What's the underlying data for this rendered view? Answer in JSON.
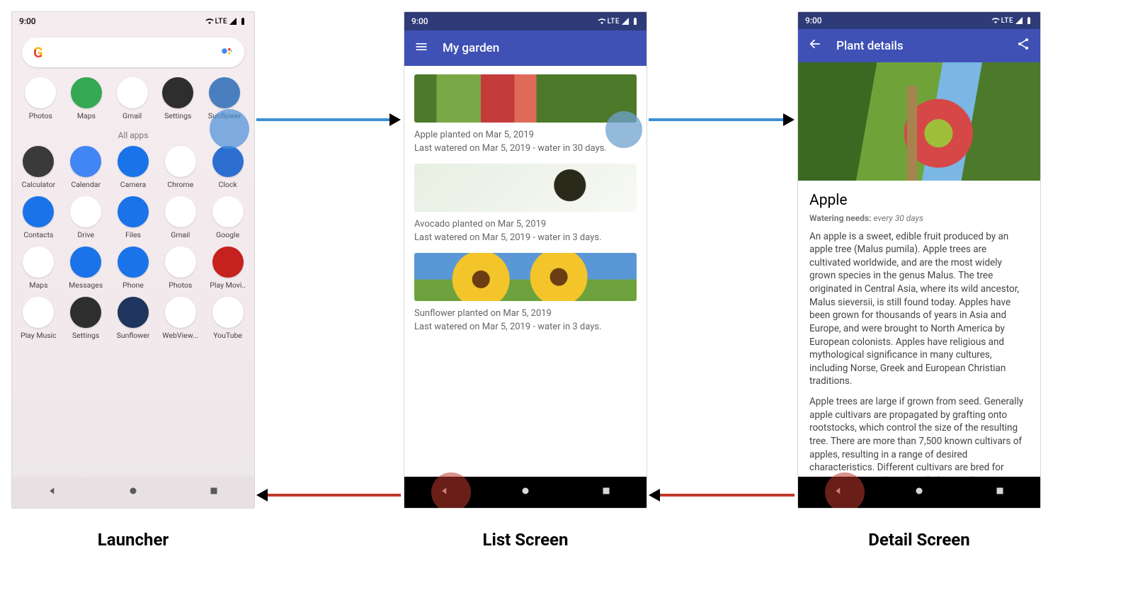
{
  "status": {
    "time": "9:00",
    "net": "LTE"
  },
  "captions": {
    "launcher": "Launcher",
    "list": "List Screen",
    "detail": "Detail Screen"
  },
  "launcher": {
    "section_label": "All apps",
    "favorites": [
      {
        "label": "Photos",
        "bg": "#fff",
        "glyph_colors": [
          "#ea4335",
          "#fbbc05",
          "#34a853",
          "#4285f4"
        ]
      },
      {
        "label": "Maps",
        "bg": "#34a853"
      },
      {
        "label": "Gmail",
        "bg": "#fff"
      },
      {
        "label": "Settings",
        "bg": "#2e2e2e"
      },
      {
        "label": "Sunflower",
        "bg": "#4a7fbf"
      }
    ],
    "apps": [
      {
        "label": "Calculator",
        "bg": "#3a3a3a"
      },
      {
        "label": "Calendar",
        "bg": "#4285f4"
      },
      {
        "label": "Camera",
        "bg": "#1a73e8"
      },
      {
        "label": "Chrome",
        "bg": "#fff"
      },
      {
        "label": "Clock",
        "bg": "#2d6fd1"
      },
      {
        "label": "Contacts",
        "bg": "#1a73e8"
      },
      {
        "label": "Drive",
        "bg": "#fff"
      },
      {
        "label": "Files",
        "bg": "#1a73e8"
      },
      {
        "label": "Gmail",
        "bg": "#fff"
      },
      {
        "label": "Google",
        "bg": "#fff"
      },
      {
        "label": "Maps",
        "bg": "#fff"
      },
      {
        "label": "Messages",
        "bg": "#1a73e8"
      },
      {
        "label": "Phone",
        "bg": "#1a73e8"
      },
      {
        "label": "Photos",
        "bg": "#fff"
      },
      {
        "label": "Play Movi..",
        "bg": "#c5221f"
      },
      {
        "label": "Play Music",
        "bg": "#fff"
      },
      {
        "label": "Settings",
        "bg": "#2e2e2e"
      },
      {
        "label": "Sunflower",
        "bg": "#1f355d"
      },
      {
        "label": "WebView...",
        "bg": "#fff"
      },
      {
        "label": "YouTube",
        "bg": "#fff"
      }
    ]
  },
  "list": {
    "title": "My garden",
    "items": [
      {
        "imgclass": "apple-img",
        "line1": "Apple planted on Mar 5, 2019",
        "line2": "Last watered on Mar 5, 2019 - water in 30 days."
      },
      {
        "imgclass": "avocado-img",
        "line1": "Avocado planted on Mar 5, 2019",
        "line2": "Last watered on Mar 5, 2019 - water in 3 days."
      },
      {
        "imgclass": "sunflower-img",
        "line1": "Sunflower planted on Mar 5, 2019",
        "line2": "Last watered on Mar 5, 2019 - water in 3 days."
      }
    ]
  },
  "detail": {
    "title": "Plant details",
    "name": "Apple",
    "watering_label": "Watering needs:",
    "watering_value": "every 30 days",
    "para1": "An apple is a sweet, edible fruit produced by an apple tree (Malus pumila). Apple trees are cultivated worldwide, and are the most widely grown species in the genus Malus. The tree originated in Central Asia, where its wild ancestor, Malus sieversii, is still found today. Apples have been grown for thousands of years in Asia and Europe, and were brought to North America by European colonists. Apples have religious and mythological significance in many cultures, including Norse, Greek and European Christian traditions.",
    "para2": "Apple trees are large if grown from seed. Generally apple cultivars are propagated by grafting onto rootstocks, which control the size of the resulting tree. There are more than 7,500 known cultivars of apples, resulting in a range of desired characteristics. Different cultivars are bred for various tastes and uses, including cooking, eating raw and cider production. Trees and fruit"
  }
}
